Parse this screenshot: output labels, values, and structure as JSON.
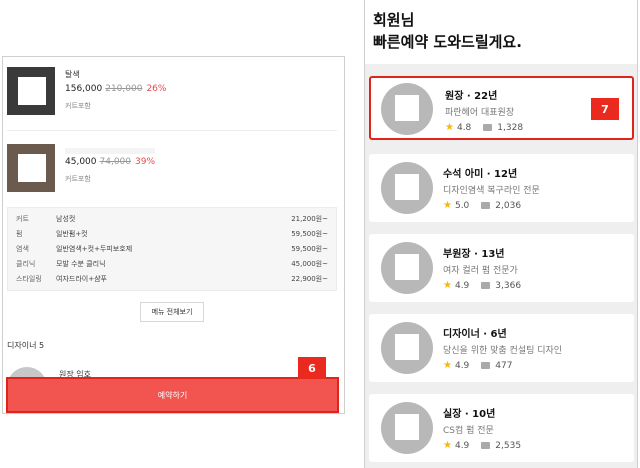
{
  "left": {
    "services": [
      {
        "name": "탈색",
        "price_now": "156,000",
        "price_old": "210,000",
        "discount": "26%",
        "option": "커트포함"
      },
      {
        "name": "",
        "price_now": "45,000",
        "price_old": "74,000",
        "discount": "39%",
        "option": "커트포함"
      }
    ],
    "menu_table": [
      {
        "category": "커트",
        "item": "남성컷",
        "price": "21,200원~"
      },
      {
        "category": "펌",
        "item": "일반펌+컷",
        "price": "59,500원~"
      },
      {
        "category": "염색",
        "item": "일반염색+컷+두피보호제",
        "price": "59,500원~"
      },
      {
        "category": "클리닉",
        "item": "모발 수분 클리닉",
        "price": "45,000원~"
      },
      {
        "category": "스타일링",
        "item": "여자드라이+샴푸",
        "price": "22,900원~"
      }
    ],
    "more_button": "메뉴 전체보기",
    "designer_heading": "디자이너 5",
    "designer_peek_name": "원장 임호",
    "reserve_button": "예약하기",
    "badge": "6"
  },
  "right": {
    "greeting_line1": "회원님",
    "greeting_line2": "빠른예약 도와드릴게요.",
    "badge": "7",
    "designers": [
      {
        "name": "원장 · 22년",
        "desc": "파란헤어 대표원장",
        "rating": "4.8",
        "reviews": "1,328"
      },
      {
        "name": "수석 아미 · 12년",
        "desc": "디자인염색 복구라인 전문",
        "rating": "5.0",
        "reviews": "2,036"
      },
      {
        "name": "부원장 · 13년",
        "desc": "여자 컬러 펌 전문가",
        "rating": "4.9",
        "reviews": "3,366"
      },
      {
        "name": "디자이너 · 6년",
        "desc": "당신을 위한 맞춤 컨설팅 디자인",
        "rating": "4.9",
        "reviews": "477"
      },
      {
        "name": "실장 · 10년",
        "desc": "CS컴 펌 전문",
        "rating": "4.9",
        "reviews": "2,535"
      }
    ]
  }
}
